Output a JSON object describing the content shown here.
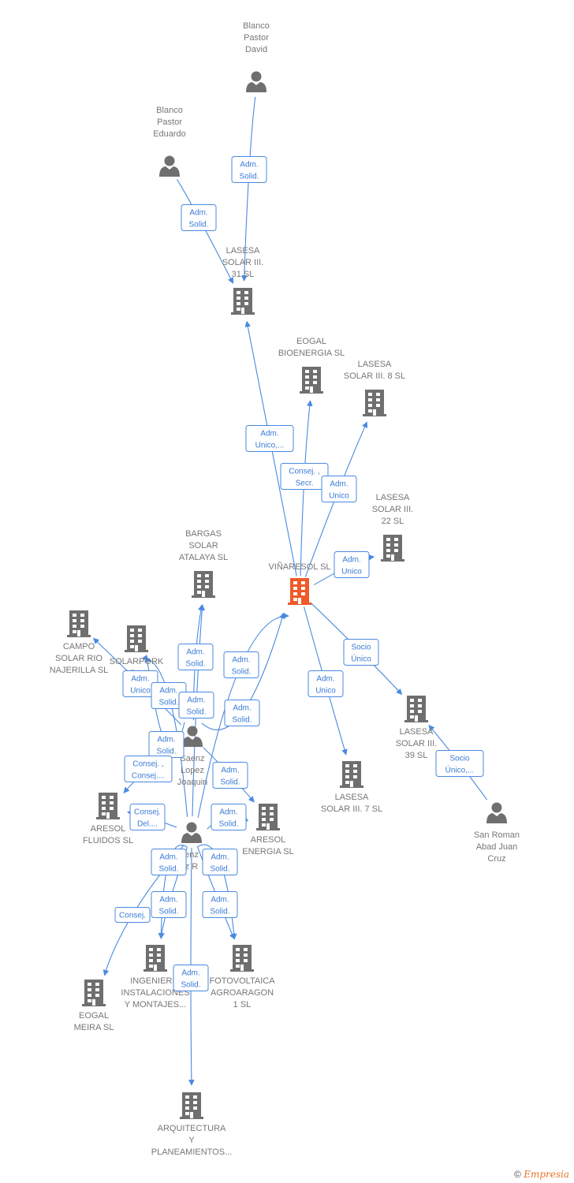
{
  "colors": {
    "accent": "#4a8ae0",
    "node": "#6f6f6f",
    "focus_node": "#f05a28",
    "label": "#777777"
  },
  "nodes": [
    {
      "id": "david",
      "type": "person",
      "lines": [
        "Blanco",
        "Pastor",
        "David"
      ]
    },
    {
      "id": "eduardo",
      "type": "person",
      "lines": [
        "Blanco",
        "Pastor",
        "Eduardo"
      ]
    },
    {
      "id": "l31",
      "type": "company",
      "lines": [
        "LASESA",
        "SOLAR III.",
        "31 SL"
      ]
    },
    {
      "id": "eogalbio",
      "type": "company",
      "lines": [
        "EOGAL",
        "BIOENERGIA SL"
      ]
    },
    {
      "id": "l8",
      "type": "company",
      "lines": [
        "LASESA",
        "SOLAR III.  8 SL"
      ]
    },
    {
      "id": "l22",
      "type": "company",
      "lines": [
        "LASESA",
        "SOLAR III.",
        "22 SL"
      ]
    },
    {
      "id": "vinaresol",
      "type": "focus",
      "lines": [
        "VIÑARESOL SL"
      ]
    },
    {
      "id": "bargas",
      "type": "company",
      "lines": [
        "BARGAS",
        "SOLAR",
        "ATALAYA SL"
      ]
    },
    {
      "id": "campo",
      "type": "company",
      "lines": [
        "CAMPO",
        "SOLAR RIO",
        "NAJERILLA SL"
      ]
    },
    {
      "id": "solarpork",
      "type": "company",
      "lines": [
        "SOLARPORK",
        "ARA    L"
      ]
    },
    {
      "id": "joaquin",
      "type": "person",
      "lines": [
        "Saenz",
        "Lopez",
        "Joaquin"
      ]
    },
    {
      "id": "p2",
      "type": "person",
      "lines": [
        "enz",
        "z R"
      ]
    },
    {
      "id": "fluidos",
      "type": "company",
      "lines": [
        "ARESOL",
        "FLUIDOS SL"
      ]
    },
    {
      "id": "energia",
      "type": "company",
      "lines": [
        "ARESOL",
        "ENERGIA SL"
      ]
    },
    {
      "id": "l7",
      "type": "company",
      "lines": [
        "LASESA",
        "SOLAR III.  7 SL"
      ]
    },
    {
      "id": "l39",
      "type": "company",
      "lines": [
        "LASESA",
        "SOLAR III.",
        "39 SL"
      ]
    },
    {
      "id": "sanroman",
      "type": "person",
      "lines": [
        "San Roman",
        "Abad Juan",
        "Cruz"
      ]
    },
    {
      "id": "ingenieria",
      "type": "company",
      "lines": [
        "INGENIERIA",
        "INSTALACIONES",
        "Y MONTAJES..."
      ]
    },
    {
      "id": "fotovoltaica",
      "type": "company",
      "lines": [
        "FOTOVOLTAICA",
        "AGROARAGON",
        "1 SL"
      ]
    },
    {
      "id": "meira",
      "type": "company",
      "lines": [
        "EOGAL",
        "MEIRA SL"
      ]
    },
    {
      "id": "arquitectura",
      "type": "company",
      "lines": [
        "ARQUITECTURA",
        "Y",
        "PLANEAMIENTOS..."
      ]
    }
  ],
  "edges": [
    {
      "from": "david",
      "to": "l31",
      "label": [
        "Adm.",
        "Solid."
      ]
    },
    {
      "from": "eduardo",
      "to": "l31",
      "label": [
        "Adm.",
        "Solid."
      ]
    },
    {
      "from": "vinaresol",
      "to": "l31",
      "label": [
        "Adm.",
        "Unico,..."
      ]
    },
    {
      "from": "vinaresol",
      "to": "eogalbio",
      "label": [
        "Consej. ,",
        "Secr."
      ]
    },
    {
      "from": "vinaresol",
      "to": "l8",
      "label": [
        "Adm.",
        "Unico"
      ]
    },
    {
      "from": "vinaresol",
      "to": "l22",
      "label": [
        "Adm.",
        "Unico"
      ]
    },
    {
      "from": "vinaresol",
      "to": "l39",
      "label": [
        "Socio",
        "Único"
      ]
    },
    {
      "from": "vinaresol",
      "to": "l7",
      "label": [
        "Adm.",
        "Unico"
      ]
    },
    {
      "from": "sanroman",
      "to": "l39",
      "label": [
        "Socio",
        "Único,..."
      ]
    },
    {
      "from": "joaquin",
      "to": "bargas",
      "label": [
        "Adm.",
        "Solid."
      ]
    },
    {
      "from": "p2",
      "to": "vinaresol",
      "label": [
        "Adm.",
        "Solid."
      ]
    },
    {
      "from": "joaquin",
      "to": "campo",
      "label": [
        "Adm.",
        "Unico"
      ]
    },
    {
      "from": "p2",
      "to": "solarpork",
      "label": [
        "Adm.",
        "Solid."
      ]
    },
    {
      "from": "p2",
      "to": "bargas",
      "label": [
        "Adm.",
        "Solid."
      ]
    },
    {
      "from": "joaquin",
      "to": "vinaresol",
      "label": [
        "Adm.",
        "Solid."
      ]
    },
    {
      "from": "joaquin",
      "to": "solarpork",
      "label": [
        "Adm.",
        "Solid."
      ]
    },
    {
      "from": "joaquin",
      "to": "fluidos",
      "label": [
        "Consej. ,",
        "Consej...."
      ]
    },
    {
      "from": "joaquin",
      "to": "energia",
      "label": [
        "Adm.",
        "Solid."
      ]
    },
    {
      "from": "p2",
      "to": "fluidos",
      "label": [
        "Consej.",
        "Del...."
      ]
    },
    {
      "from": "p2",
      "to": "energia",
      "label": [
        "Adm.",
        "Solid."
      ]
    },
    {
      "from": "p2",
      "to": "ingenieria",
      "label": [
        "Adm.",
        "Solid."
      ]
    },
    {
      "from": "p2",
      "to": "fotovoltaica",
      "label": [
        "Adm.",
        "Solid."
      ]
    },
    {
      "from": "p2",
      "to": "ingenieria",
      "label": [
        "Adm.",
        "Solid."
      ]
    },
    {
      "from": "p2",
      "to": "fotovoltaica",
      "label": [
        "Adm.",
        "Solid."
      ]
    },
    {
      "from": "p2",
      "to": "meira",
      "label": [
        "Consej."
      ]
    },
    {
      "from": "p2",
      "to": "arquitectura",
      "label": [
        "Adm.",
        "Solid."
      ]
    }
  ],
  "footer": {
    "copyright": "©",
    "brand": "Empresia"
  }
}
